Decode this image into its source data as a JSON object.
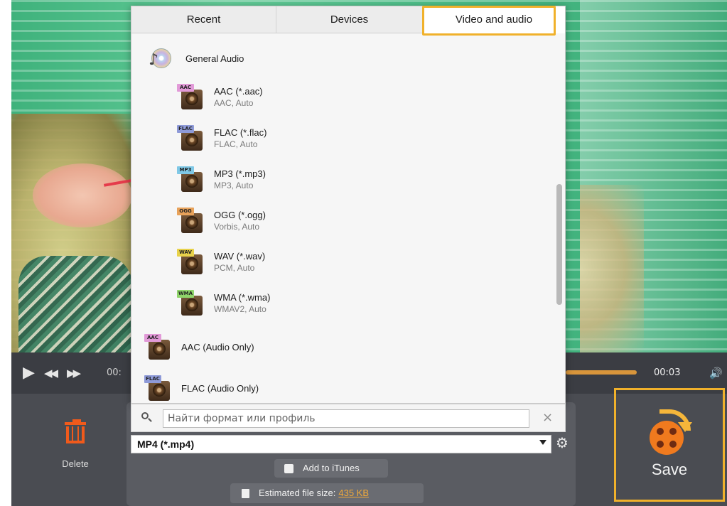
{
  "player": {
    "time_start": "00:",
    "time_end": "00:03",
    "progress": 1.0
  },
  "tabs": [
    {
      "label": "Recent",
      "active": false
    },
    {
      "label": "Devices",
      "active": false
    },
    {
      "label": "Video and audio",
      "active": true
    }
  ],
  "formats": {
    "general": {
      "label": "General Audio",
      "icon": "audio-disc-icon"
    },
    "items": [
      {
        "tag": "AAC",
        "tag_color": "#e29ad8",
        "name": "AAC (*.aac)",
        "sub": "AAC, Auto"
      },
      {
        "tag": "FLAC",
        "tag_color": "#8e9ad8",
        "name": "FLAC (*.flac)",
        "sub": "FLAC, Auto"
      },
      {
        "tag": "MP3",
        "tag_color": "#7fc8e6",
        "name": "MP3 (*.mp3)",
        "sub": "MP3, Auto"
      },
      {
        "tag": "OGG",
        "tag_color": "#e8a25a",
        "name": "OGG (*.ogg)",
        "sub": "Vorbis, Auto"
      },
      {
        "tag": "WAV",
        "tag_color": "#e8d24a",
        "name": "WAV (*.wav)",
        "sub": "PCM, Auto"
      },
      {
        "tag": "WMA",
        "tag_color": "#8fd46a",
        "name": "WMA (*.wma)",
        "sub": "WMAV2, Auto"
      }
    ],
    "audio_only": [
      {
        "tag": "AAC",
        "tag_color": "#e29ad8",
        "name": "AAC (Audio Only)"
      },
      {
        "tag": "FLAC",
        "tag_color": "#8e9ad8",
        "name": "FLAC (Audio Only)"
      }
    ]
  },
  "search": {
    "placeholder": "Найти формат или профиль",
    "clear": "×"
  },
  "format_select": {
    "value": "MP4 (*.mp4)"
  },
  "gear": "⚙",
  "itunes": {
    "label": "Add to iTunes",
    "checked": false
  },
  "filesize": {
    "label": "Estimated file size:",
    "value": "435 KB"
  },
  "delete": {
    "label": "Delete"
  },
  "save": {
    "label": "Save"
  },
  "colors": {
    "accent": "#f0b12b",
    "delete": "#f15a1b",
    "progress": "#d8953b"
  }
}
